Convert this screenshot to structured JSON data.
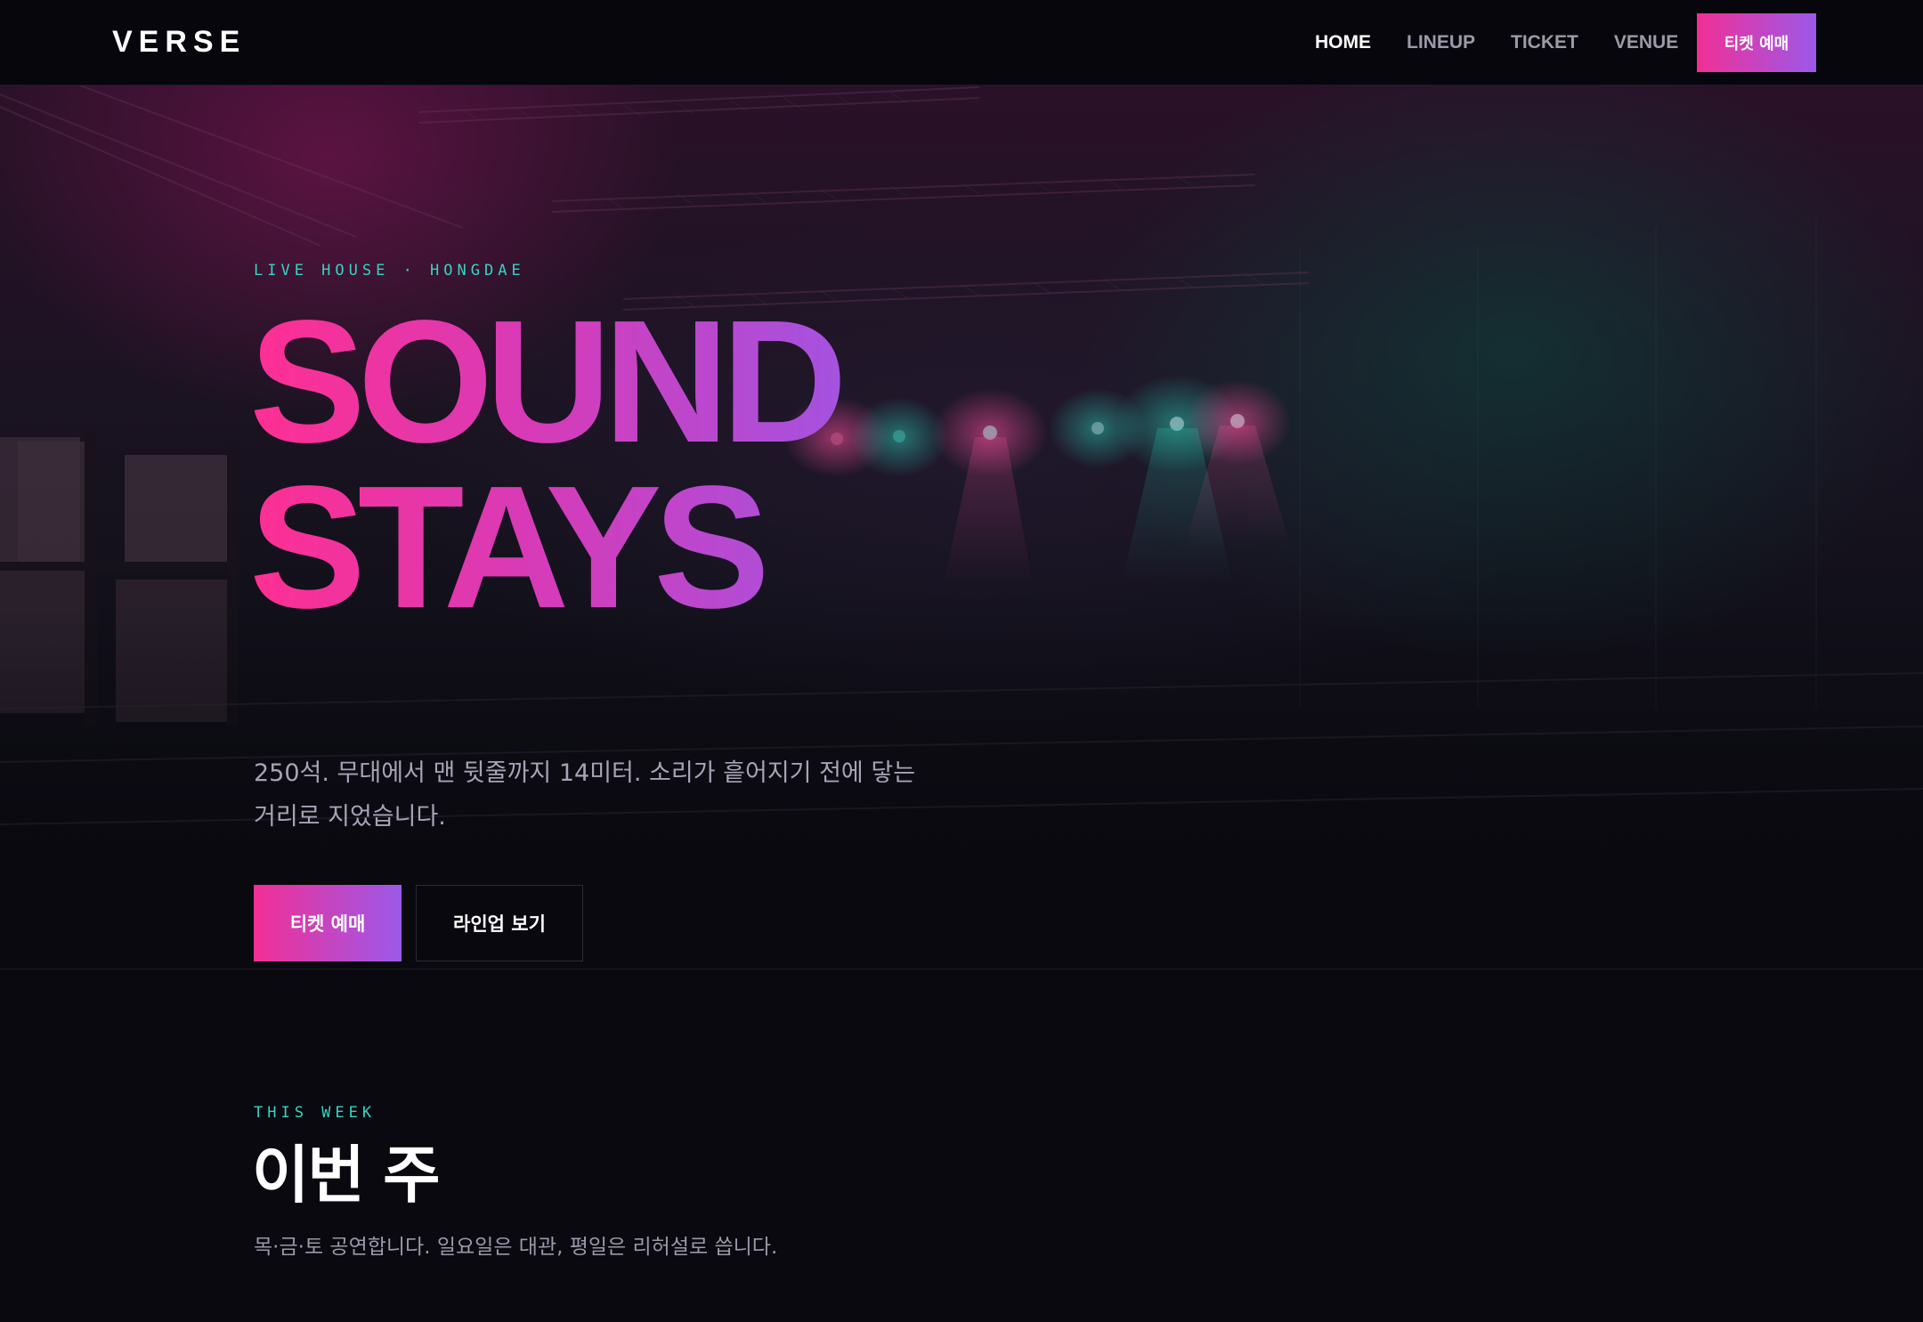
{
  "nav": {
    "logo": "VERSE",
    "links": [
      {
        "label": "HOME",
        "active": true
      },
      {
        "label": "LINEUP",
        "active": false
      },
      {
        "label": "TICKET",
        "active": false
      },
      {
        "label": "VENUE",
        "active": false
      }
    ],
    "cta_label": "티켓 예매"
  },
  "hero": {
    "eyebrow": "LIVE HOUSE · HONGDAE",
    "headline_line1": "SOUND",
    "headline_line2": "STAYS",
    "description": "250석. 무대에서 맨 뒷줄까지 14미터. 소리가 흩어지기 전에 닿는 거리로 지었습니다.",
    "primary_button": "티켓 예매",
    "secondary_button": "라인업 보기"
  },
  "this_week": {
    "eyebrow": "THIS WEEK",
    "title": "이번 주",
    "description": "목·금·토 공연합니다. 일요일은 대관, 평일은 리허설로 씁니다."
  },
  "colors": {
    "accent_pink": "#f22f95",
    "accent_purple": "#9b59ea",
    "accent_teal": "#35d4c4",
    "background": "#0a0910"
  }
}
